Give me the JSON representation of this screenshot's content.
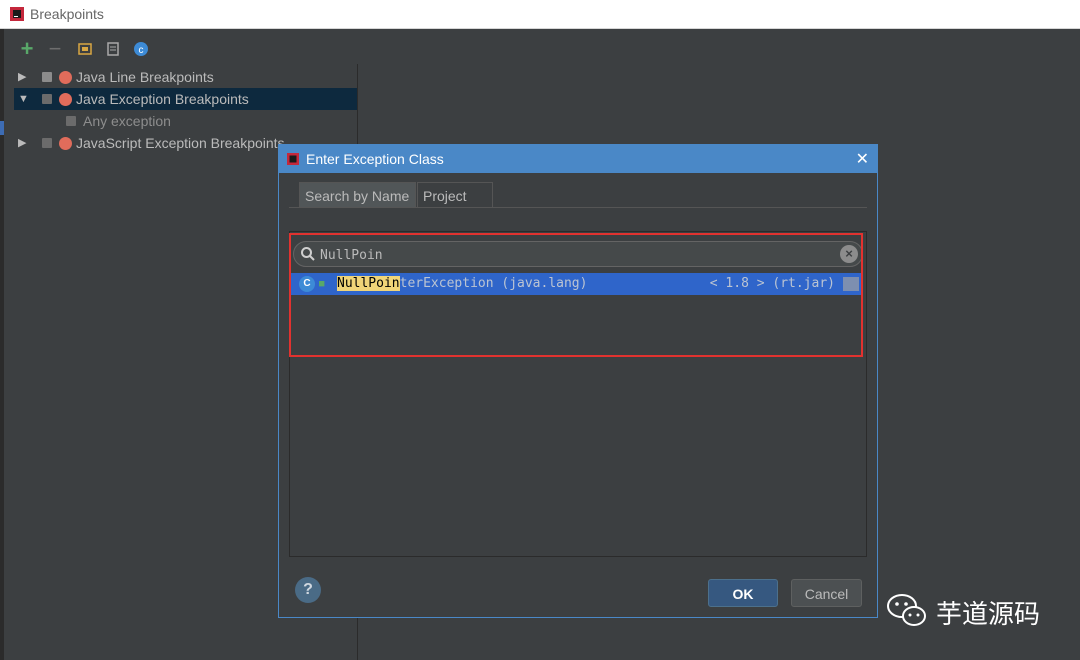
{
  "window": {
    "title": "Breakpoints"
  },
  "toolbar": {
    "icons": [
      "add-icon",
      "remove-icon",
      "group-icon",
      "file-icon",
      "class-icon"
    ]
  },
  "tree": {
    "items": [
      {
        "label": "Java Line Breakpoints",
        "expanded": false,
        "checked": true
      },
      {
        "label": "Java Exception Breakpoints",
        "expanded": true,
        "checked": false,
        "selected": true
      },
      {
        "label": "Any exception",
        "child": true
      },
      {
        "label": "JavaScript Exception Breakpoints",
        "expanded": false,
        "checked": false
      }
    ]
  },
  "dialog": {
    "title": "Enter Exception Class",
    "tabs": [
      {
        "label": "Search by Name",
        "active": true
      },
      {
        "label": "Project",
        "active": false
      }
    ],
    "search": {
      "value": "NullPoin"
    },
    "result": {
      "match": "NullPoin",
      "rest": "terException (java.lang)",
      "location": "< 1.8 > (rt.jar)"
    },
    "ok_label": "OK",
    "cancel_label": "Cancel",
    "help_label": "?"
  },
  "watermark": {
    "text": "芋道源码"
  },
  "colors": {
    "accent": "#4a88c7",
    "selection": "#2f65ca",
    "highlight": "#f0d478",
    "annotation_frame": "#e2322f",
    "breakpoint": "#e06c5b"
  }
}
